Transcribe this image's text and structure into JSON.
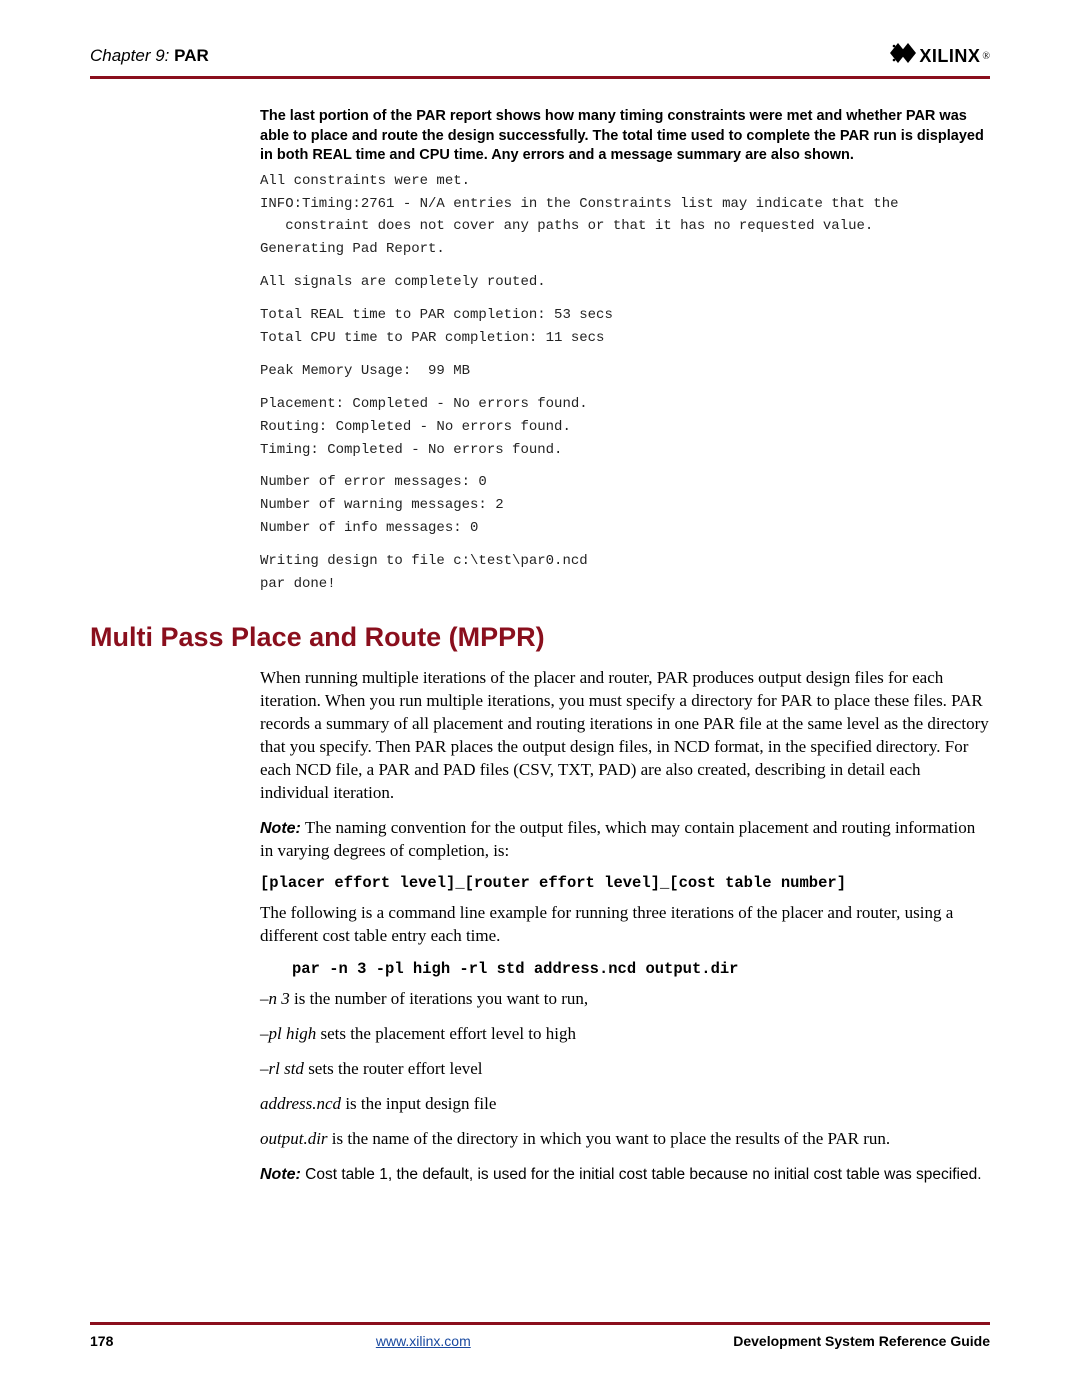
{
  "header": {
    "chapter_prefix": "Chapter 9:",
    "chapter_title": "PAR",
    "logo_text": "XILINX",
    "logo_reg": "®"
  },
  "intro_bold": "The last portion of the PAR report shows how many timing constraints were met and whether PAR was able to place and route the design successfully. The total time used to complete the PAR run is displayed in both REAL time and CPU time.  Any errors and a message summary are also shown.",
  "mono_lines": {
    "l1": "All constraints were met.",
    "l2": "INFO:Timing:2761 - N/A entries in the Constraints list may indicate that the",
    "l3": "   constraint does not cover any paths or that it has no requested value.",
    "l4": "Generating Pad Report.",
    "l5": "All signals are completely routed.",
    "l6": "Total REAL time to PAR completion: 53 secs",
    "l7": "Total CPU time to PAR completion: 11 secs",
    "l8": "Peak Memory Usage:  99 MB",
    "l9": "Placement: Completed - No errors found.",
    "l10": "Routing: Completed - No errors found.",
    "l11": "Timing: Completed - No errors found.",
    "l12": "Number of error messages: 0",
    "l13": "Number of warning messages: 2",
    "l14": "Number of info messages: 0",
    "l15": "Writing design to file c:\\test\\par0.ncd",
    "l16": "par done!"
  },
  "section_title": "Multi Pass Place and Route (MPPR)",
  "p1": "When running multiple iterations of the placer and router, PAR produces output design files for each iteration. When you run multiple iterations, you must specify a directory for PAR to place these files. PAR records a summary of all placement and routing iterations in one PAR file at the same level as the directory that you specify. Then PAR places the output design files, in NCD format, in the specified directory. For each NCD file, a PAR and PAD files (CSV, TXT, PAD) are also created, describing in detail each individual iteration.",
  "note1_label": "Note:",
  "note1_text": "The naming convention for the output files, which may contain placement and routing information in varying degrees of completion, is:",
  "code1": "[placer effort level]_[router effort level]_[cost table number]",
  "p2": "The following is a command line example for running three iterations of the placer and router, using a different cost table entry each time.",
  "code2": "par -n 3 -pl high -rl std address.ncd output.dir",
  "li1_em": "–n 3",
  "li1_rest": " is the number of iterations you want to run,",
  "li2_em": "–pl high",
  "li2_rest": " sets the placement effort level to high",
  "li3_em": "–rl std",
  "li3_rest": " sets the router effort level",
  "li4_em": "address.ncd",
  "li4_rest": " is the input design file",
  "li5_em": "output.dir",
  "li5_rest": " is the name of the directory in which you want to place the results of the PAR run.",
  "note2_label": "Note:",
  "note2_text": "Cost table 1, the default, is used for the initial cost table because no initial cost table was specified.",
  "footer": {
    "page": "178",
    "url": "www.xilinx.com",
    "doc": "Development System Reference Guide"
  }
}
